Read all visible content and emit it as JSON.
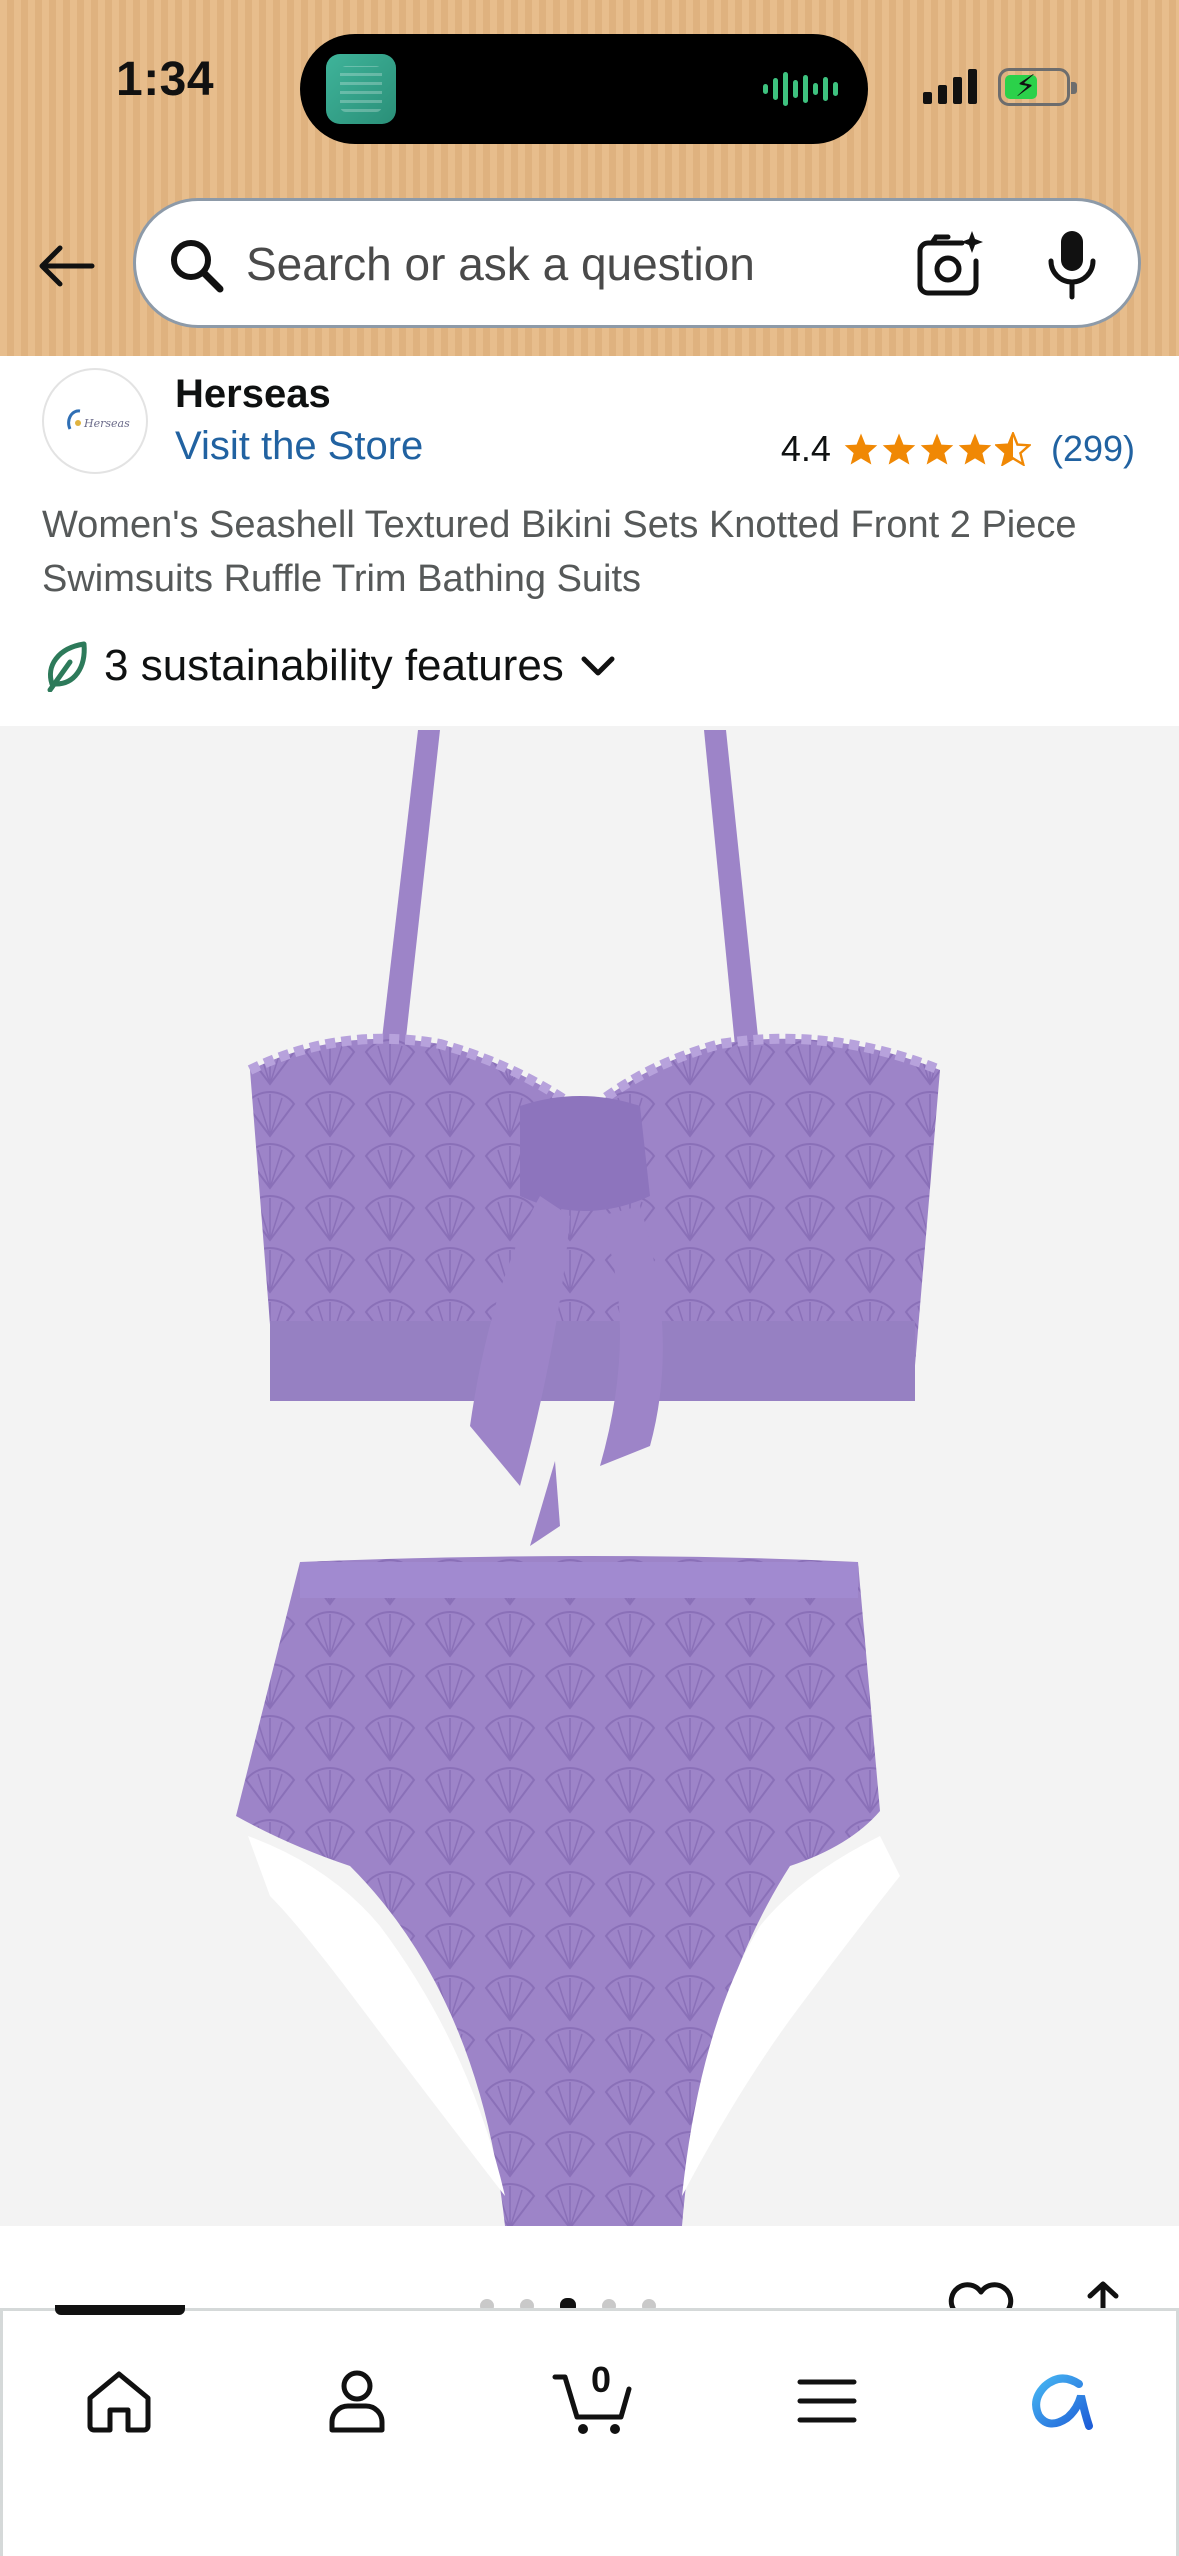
{
  "status_bar": {
    "time": "1:34"
  },
  "search": {
    "placeholder": "Search or ask a question"
  },
  "store": {
    "name": "Herseas",
    "logo_text": "Herseas",
    "visit_label": "Visit the Store"
  },
  "rating": {
    "value": "4.4",
    "stars": 4.4,
    "count": "(299)"
  },
  "product": {
    "title": "Women's Seashell Textured Bikini Sets Knotted Front 2 Piece Swimsuits Ruffle Trim Bathing Suits",
    "sustainability_label": "3 sustainability features",
    "image_color": "#9d84c8"
  },
  "carousel": {
    "active_index": 2,
    "count": 5
  },
  "nav": {
    "items": [
      {
        "name": "home",
        "icon": "home-icon"
      },
      {
        "name": "account",
        "icon": "person-icon"
      },
      {
        "name": "cart",
        "icon": "cart-icon"
      },
      {
        "name": "menu",
        "icon": "menu-icon"
      },
      {
        "name": "rufus",
        "icon": "rufus-icon"
      }
    ],
    "cart_count": "0"
  },
  "colors": {
    "header_bg": "#e7bd8c",
    "link": "#2162a1",
    "star": "#f08804",
    "leaf": "#2d7a5a"
  }
}
